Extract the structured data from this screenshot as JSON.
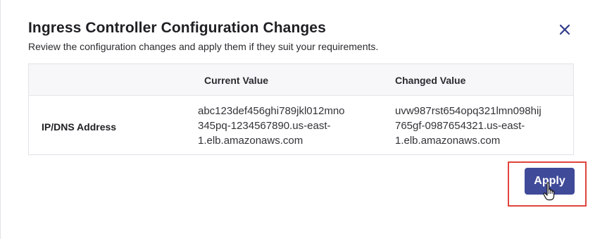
{
  "dialog": {
    "title": "Ingress Controller Configuration Changes",
    "subtitle": "Review the configuration changes and apply them if they suit your requirements.",
    "close_icon": "close-icon"
  },
  "table": {
    "headers": [
      "",
      "Current Value",
      "Changed Value"
    ],
    "rows": [
      {
        "label": "IP/DNS Address",
        "current": "abc123def456ghi789jkl012mno\n345pq-1234567890.us-east-\n1.elb.amazonaws.com",
        "changed": "uvw987rst654opq321lmn098hij\n765gf-0987654321.us-east-\n1.elb.amazonaws.com"
      }
    ]
  },
  "actions": {
    "apply_label": "Apply"
  },
  "colors": {
    "primary": "#3f4a99",
    "highlight": "#e0453e",
    "close_icon": "#2f3a8a"
  }
}
